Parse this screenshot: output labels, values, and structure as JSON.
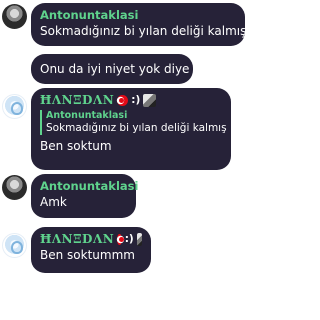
{
  "messages": [
    {
      "sender": "Antonuntaklasi",
      "lines": [
        "Sokmadığınız bi yılan deliği kalmış",
        "Onu da iyi niyet yok diye"
      ]
    },
    {
      "sender": "ĦΛNΞDΛN",
      "sender_suffix": ":)",
      "reply_to": {
        "sender": "Antonuntaklasi",
        "text": "Sokmadığınız bi yılan deliği kalmış"
      },
      "lines": [
        "Ben soktum"
      ]
    },
    {
      "sender": "Antonuntaklasi",
      "lines": [
        "Amk"
      ]
    },
    {
      "sender": "ĦΛNΞDΛN",
      "sender_suffix": ":)",
      "lines": [
        "Ben soktummm"
      ]
    }
  ],
  "colors": {
    "bubble": "#262238",
    "sender_name": "#5fd38d",
    "text": "#ffffff",
    "background": "#ffffff"
  }
}
